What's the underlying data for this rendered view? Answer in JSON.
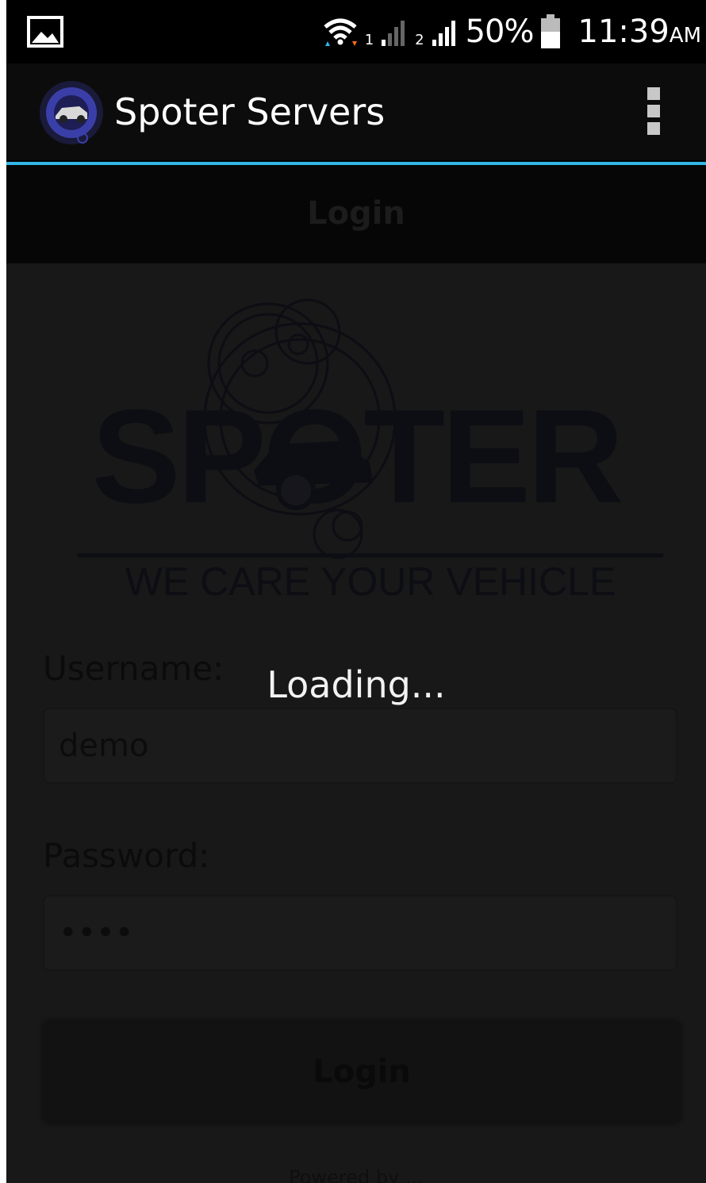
{
  "status_bar": {
    "battery_percent": "50%",
    "time": "11:39",
    "time_suffix": "AM",
    "sim1": "1",
    "sim2": "2"
  },
  "action_bar": {
    "title": "Spoter Servers"
  },
  "page": {
    "header_title": "Login",
    "logo_text": "SPOTER",
    "logo_tagline": "WE CARE YOUR VEHICLE",
    "username_label": "Username:",
    "username_value": "demo",
    "password_label": "Password:",
    "password_value": "••••",
    "login_button": "Login",
    "footer": "Powered by ..."
  },
  "overlay": {
    "loading_text": "Loading..."
  },
  "colors": {
    "accent": "#33b5e5",
    "logo_color": "#0d0d14"
  }
}
